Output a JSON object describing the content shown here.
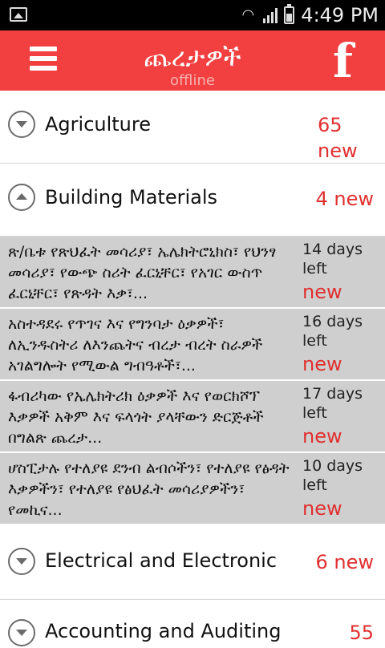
{
  "status_bar": {
    "time": "4:49 PM"
  },
  "app_bar": {
    "title": "ጨረታዎች",
    "subtitle": "offline",
    "fb_label": "f"
  },
  "categories": [
    {
      "name": "Agriculture",
      "count": "65",
      "count_suffix": "new"
    },
    {
      "name": "Building Materials",
      "count": "4 new"
    },
    {
      "name": "Electrical and Electronic",
      "count": "6 new"
    },
    {
      "name": "Accounting and Auditing",
      "count": "55"
    }
  ],
  "tenders": [
    {
      "description": "ጽ/ቤቱ የጽህፈት መሳሪያ፣ ኤሌክትሮኒክስ፣ የህንፃ መሳሪያ፣ የውጭ ስሪት ፈርኒቸር፣ የአገር ውስጥ ፈርኒቸር፣ የጽዳት እቃ፣...",
      "days": "14 days left",
      "badge": "new"
    },
    {
      "description": "አስተዳደሩ የጥገና እና የግንባታ ዕቃዎች፣ ለኢንዱስትሪ ለእንጨትና ብረታ ብረት ስራዎች አገልግሎት የሚውል ግብዓቶች፣...",
      "days": "16 days left",
      "badge": "new"
    },
    {
      "description": "ፋብሪካው የኤሌክትሪክ ዕቃዎች እና የወርክሾፕ እቃዎች አቅም እና ፍላጎት ያላቸውን ድርጅቶች በግልጽ ጨረታ...",
      "days": "17 days left",
      "badge": "new"
    },
    {
      "description": "ሆስፒታሉ የተለያዩ ደንብ ልብሶችን፣ የተለያዩ የፅዳት እቃዎችን፣ የተለያዩ የፅህፈት መሳሪያዎችን፣ የመኪና...",
      "days": "10 days left",
      "badge": "new"
    }
  ]
}
